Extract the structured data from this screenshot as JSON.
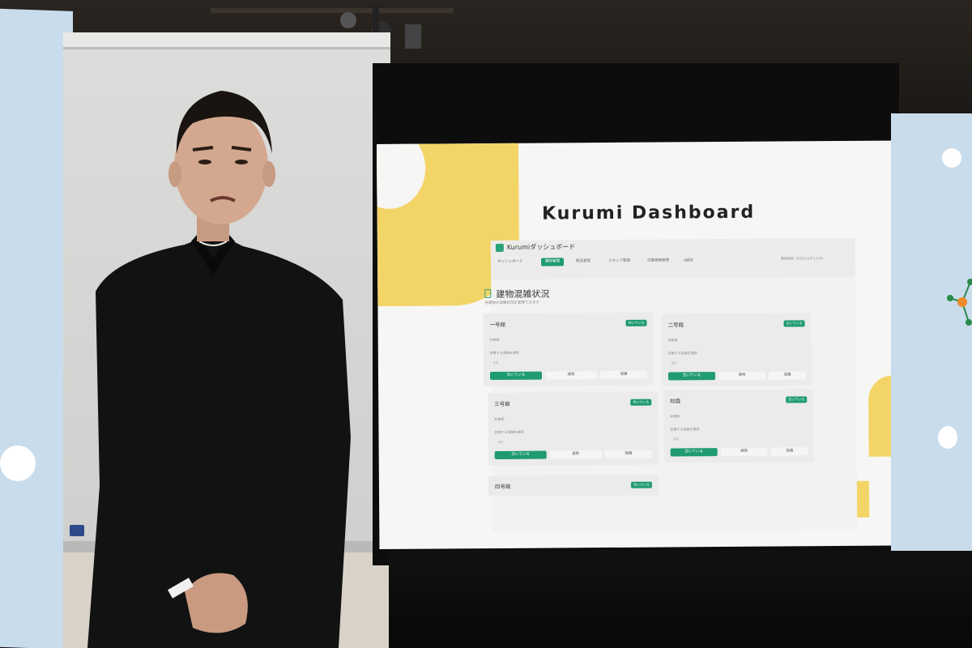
{
  "dashboard": {
    "title": "Kurumi Dashboard",
    "app_name": "Kurumiダッシュボード",
    "updated_label": "最終更新: 2025/11/9 11:04",
    "nav": [
      {
        "label": "ダッシュボード",
        "active": false
      },
      {
        "label": "建物管理",
        "active": true
      },
      {
        "label": "製品管理",
        "active": false
      },
      {
        "label": "スタンプ管理",
        "active": false
      },
      {
        "label": "位置情報管理",
        "active": false
      },
      {
        "label": "q設定",
        "active": false
      }
    ],
    "page_heading": "建物混雑状況",
    "page_subtitle": "各建物の混雑状況を管理できます",
    "cards": [
      {
        "name": "一号館",
        "badge": "空いている",
        "usage_label": "利用率",
        "change_label": "変更する混雑を選択",
        "value": "0/2",
        "buttons": [
          "空いている",
          "通常",
          "混雑"
        ]
      },
      {
        "name": "二号館",
        "badge": "空いている",
        "usage_label": "利用率",
        "change_label": "変更する混雑を選択",
        "value": "0/1",
        "buttons": [
          "空いている",
          "通常",
          "混雑"
        ]
      },
      {
        "name": "三号館",
        "badge": "空いている",
        "usage_label": "利用率",
        "change_label": "変更する混雑を選択",
        "value": "0/4",
        "buttons": [
          "空いている",
          "通常",
          "混雑"
        ]
      },
      {
        "name": "校庭",
        "badge": "空いている",
        "usage_label": "利用率",
        "change_label": "変更する混雑を選択",
        "value": "0/5",
        "buttons": [
          "空いている",
          "通常",
          "混雑"
        ]
      },
      {
        "name": "四号館",
        "badge": "空いている"
      }
    ]
  },
  "colors": {
    "accent": "#1f9b6f",
    "decor_yellow": "#f3d466",
    "side_screen": "#c9dcec"
  }
}
